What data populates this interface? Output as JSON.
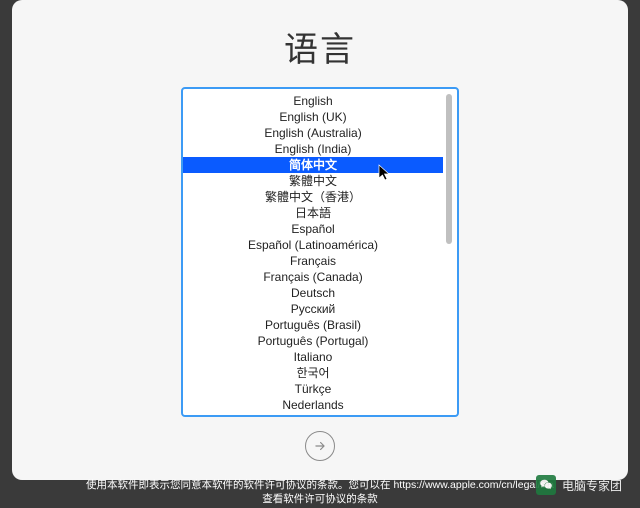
{
  "title": "语言",
  "selected_index": 4,
  "languages": [
    "English",
    "English (UK)",
    "English (Australia)",
    "English (India)",
    "简体中文",
    "繁體中文",
    "繁體中文（香港）",
    "日本語",
    "Español",
    "Español (Latinoamérica)",
    "Français",
    "Français (Canada)",
    "Deutsch",
    "Русский",
    "Português (Brasil)",
    "Português (Portugal)",
    "Italiano",
    "한국어",
    "Türkçe",
    "Nederlands"
  ],
  "footer_line1": "使用本软件即表示您同意本软件的软件许可协议的条款。您可以在 https://www.apple.com/cn/legal/sla",
  "footer_line2": "查看软件许可协议的条款",
  "watermark_text": "电脑专家团"
}
